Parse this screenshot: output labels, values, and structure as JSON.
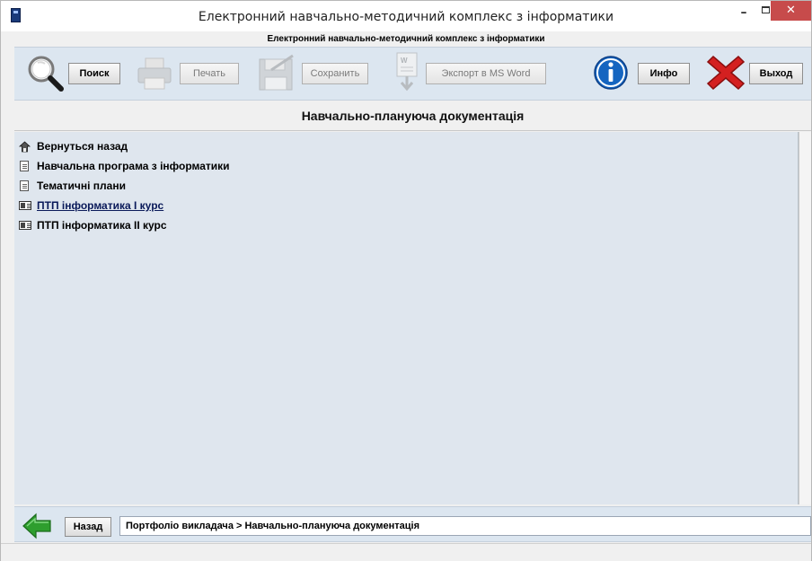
{
  "window": {
    "title": "Електронний навчально-методичний комплекс з інформатики",
    "min_glyph": "–",
    "close_glyph": "✕"
  },
  "app": {
    "subtitle": "Електронний навчально-методичний комплекс з інформатики"
  },
  "toolbar": {
    "search": {
      "label": "Поиск",
      "icon": "magnifier-icon",
      "enabled": true
    },
    "print": {
      "label": "Печать",
      "icon": "printer-icon",
      "enabled": false
    },
    "save": {
      "label": "Сохранить",
      "icon": "floppy-disk-icon",
      "enabled": false
    },
    "export": {
      "label": "Экспорт в MS Word",
      "icon": "word-document-icon",
      "enabled": false
    },
    "info": {
      "label": "Инфо",
      "icon": "info-icon",
      "enabled": true
    },
    "exit": {
      "label": "Выход",
      "icon": "red-x-icon",
      "enabled": true
    }
  },
  "section": {
    "title": "Навчально-плануюча документація"
  },
  "list": {
    "items": [
      {
        "label": "Вернуться назад",
        "icon": "up-folder-icon",
        "link": false
      },
      {
        "label": "Навчальна програма з інформатики",
        "icon": "document-icon",
        "link": false
      },
      {
        "label": "Тематичні плани",
        "icon": "document-icon",
        "link": false
      },
      {
        "label": "ПТП інформатика І курс",
        "icon": "presentation-icon",
        "link": true
      },
      {
        "label": "ПТП інформатика ІІ курс",
        "icon": "presentation-icon",
        "link": false
      }
    ]
  },
  "footer": {
    "back_label": "Назад",
    "back_icon": "green-left-arrow-icon",
    "breadcrumb": "Портфоліо викладача  >  Навчально-плануюча документація"
  },
  "colors": {
    "panel_bg": "#dfe6ee",
    "toolbar_bg": "#dce6f0",
    "close_red": "#c74b4b",
    "info_blue": "#1565c0",
    "back_green": "#2e9e2e"
  }
}
